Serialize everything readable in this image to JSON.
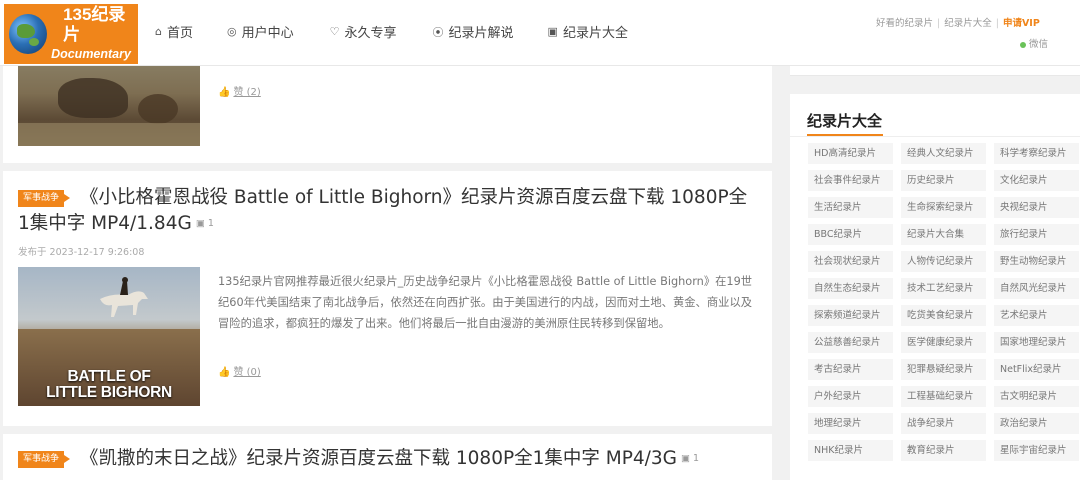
{
  "logo": {
    "line1": "135纪录片",
    "line2": "Documentary"
  },
  "nav": [
    {
      "icon": "⌂",
      "label": "首页"
    },
    {
      "icon": "◎",
      "label": "用户中心"
    },
    {
      "icon": "♡",
      "label": "永久专享"
    },
    {
      "icon": "⦿",
      "label": "纪录片解说"
    },
    {
      "icon": "▣",
      "label": "纪录片大全"
    }
  ],
  "toplinks": {
    "link1": "好看的纪录片",
    "sep": "|",
    "link2": "纪录片大全",
    "vip": "申请VIP",
    "wechat": "微信"
  },
  "posts": [
    {
      "likes_icon": "👍",
      "likes": "赞 (2)"
    },
    {
      "tag": "军事战争",
      "title": "《小比格霍恩战役 Battle of Little Bighorn》纪录片资源百度云盘下载 1080P全1集中字 MP4/1.84G",
      "count": "1",
      "date": "发布于 2023-12-17 9:26:08",
      "thumb_caption_1": "BATTLE OF",
      "thumb_caption_2": "LITTLE BIGHORN",
      "excerpt": "135纪录片官网推荐最近很火纪录片_历史战争纪录片《小比格霍恩战役 Battle of Little Bighorn》在19世纪60年代美国结束了南北战争后，依然还在向西扩张。由于美国进行的内战，因而对土地、黄金、商业以及冒险的追求，都疯狂的爆发了出来。他们将最后一批自由漫游的美洲原住民转移到保留地。",
      "likes": "赞 (0)"
    },
    {
      "tag": "军事战争",
      "title": "《凯撒的末日之战》纪录片资源百度云盘下载 1080P全1集中字 MP4/3G",
      "count": "1"
    }
  ],
  "sidebar": {
    "title": "纪录片大全",
    "items": [
      "HD高清纪录片",
      "经典人文纪录片",
      "科学考察纪录片",
      "社会事件纪录片",
      "历史纪录片",
      "文化纪录片",
      "生活纪录片",
      "生命探索纪录片",
      "央视纪录片",
      "BBC纪录片",
      "纪录片大合集",
      "旅行纪录片",
      "社会现状纪录片",
      "人物传记纪录片",
      "野生动物纪录片",
      "自然生态纪录片",
      "技术工艺纪录片",
      "自然风光纪录片",
      "探索频道纪录片",
      "吃货美食纪录片",
      "艺术纪录片",
      "公益慈善纪录片",
      "医学健康纪录片",
      "国家地理纪录片",
      "考古纪录片",
      "犯罪悬疑纪录片",
      "NetFlix纪录片",
      "户外纪录片",
      "工程基础纪录片",
      "古文明纪录片",
      "地理纪录片",
      "战争纪录片",
      "政治纪录片",
      "NHK纪录片",
      "教育纪录片",
      "星际宇宙纪录片"
    ]
  }
}
